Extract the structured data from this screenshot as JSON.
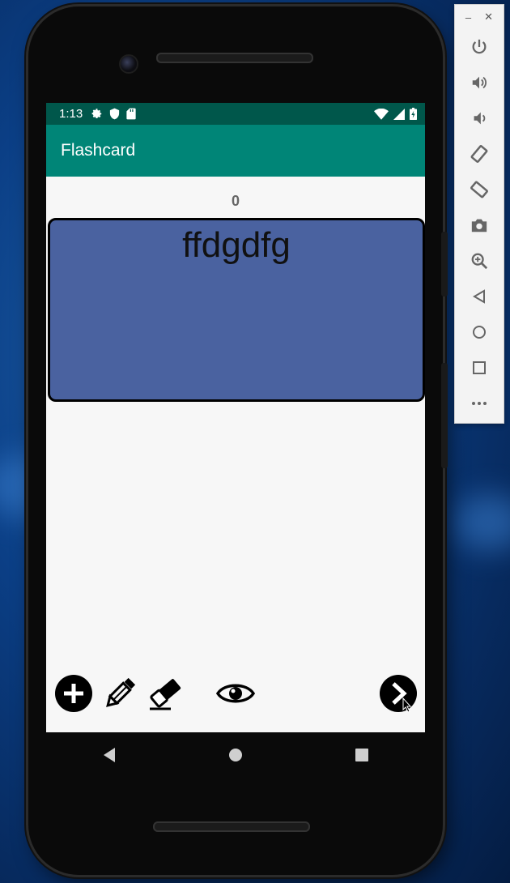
{
  "status_bar": {
    "time": "1:13"
  },
  "app_bar": {
    "title": "Flashcard"
  },
  "counter": "0",
  "card": {
    "text": "ffdgdfg"
  },
  "toolbar": {
    "actions": [
      "add",
      "edit",
      "delete",
      "reveal",
      "next"
    ]
  },
  "emulator_panel": {
    "window_controls": [
      "–",
      "✕"
    ],
    "buttons": [
      "power",
      "volume-up",
      "volume-down",
      "rotate-left",
      "rotate-right",
      "screenshot",
      "zoom",
      "back",
      "home",
      "overview",
      "more"
    ]
  },
  "colors": {
    "status_bar": "#00574b",
    "app_bar": "#008577",
    "card": "#4a62a0",
    "screen_bg": "#f7f7f7"
  }
}
